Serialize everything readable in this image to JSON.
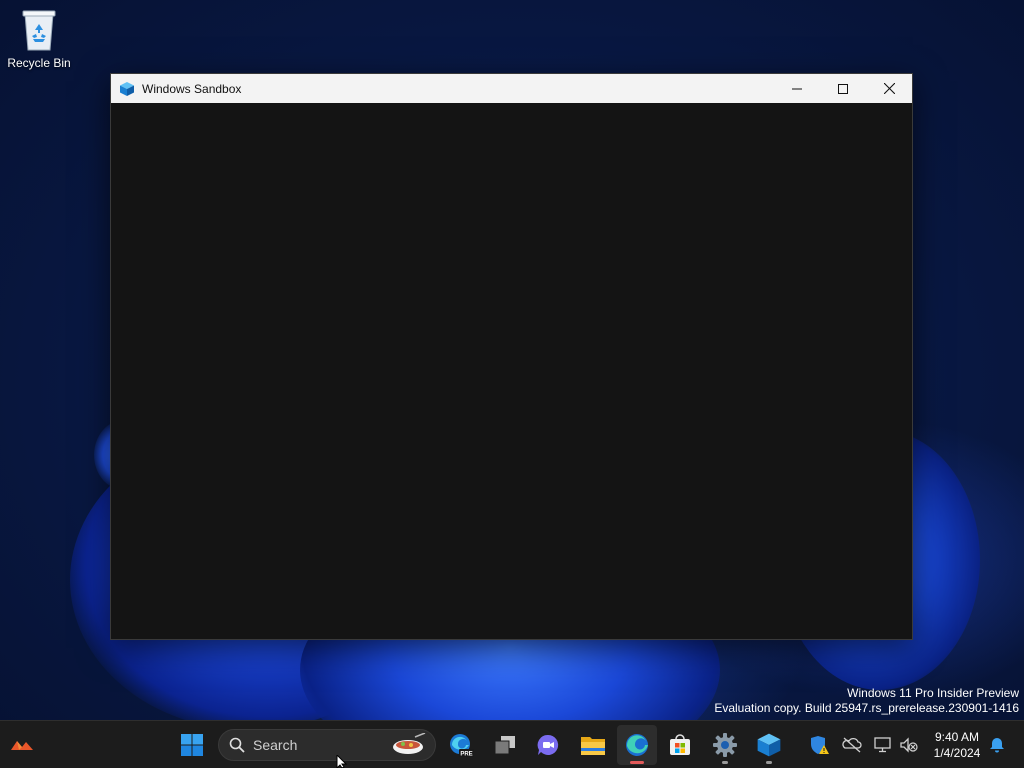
{
  "desktop": {
    "icons": [
      {
        "label": "Recycle Bin",
        "icon": "recycle-bin-icon"
      }
    ],
    "watermark": {
      "line1": "Windows 11 Pro Insider Preview",
      "line2": "Evaluation copy. Build 25947.rs_prerelease.230901-1416"
    }
  },
  "window": {
    "title": "Windows Sandbox",
    "icon": "sandbox-icon",
    "controls": [
      "minimize-icon",
      "maximize-icon",
      "close-icon"
    ],
    "content_color": "#141414"
  },
  "taskbar": {
    "search": {
      "placeholder": "Search"
    },
    "pinned": [
      {
        "name": "widgets",
        "icon": "widgets-icon"
      },
      {
        "name": "start",
        "icon": "windows-logo-icon"
      },
      {
        "name": "edge-preview",
        "icon": "edge-pre-icon",
        "badge": "PRE"
      },
      {
        "name": "task-view",
        "icon": "task-view-icon"
      },
      {
        "name": "teams-chat",
        "icon": "chat-icon"
      },
      {
        "name": "file-explorer",
        "icon": "folder-icon"
      },
      {
        "name": "edge",
        "icon": "edge-icon",
        "active": true
      },
      {
        "name": "store",
        "icon": "store-icon"
      },
      {
        "name": "settings",
        "icon": "gear-icon",
        "running": true
      },
      {
        "name": "sandbox",
        "icon": "sandbox-icon",
        "running": true
      }
    ],
    "tray": [
      "defender-warning-icon",
      "network-offline-icon",
      "display-icon",
      "volume-muted-icon"
    ],
    "clock": {
      "time": "9:40 AM",
      "date": "1/4/2024"
    },
    "notification_icon": "bell-icon"
  },
  "colors": {
    "taskbar_bg": "#1c1c1c",
    "titlebar_bg": "#f3f3f3",
    "accent": "#0078d4"
  }
}
